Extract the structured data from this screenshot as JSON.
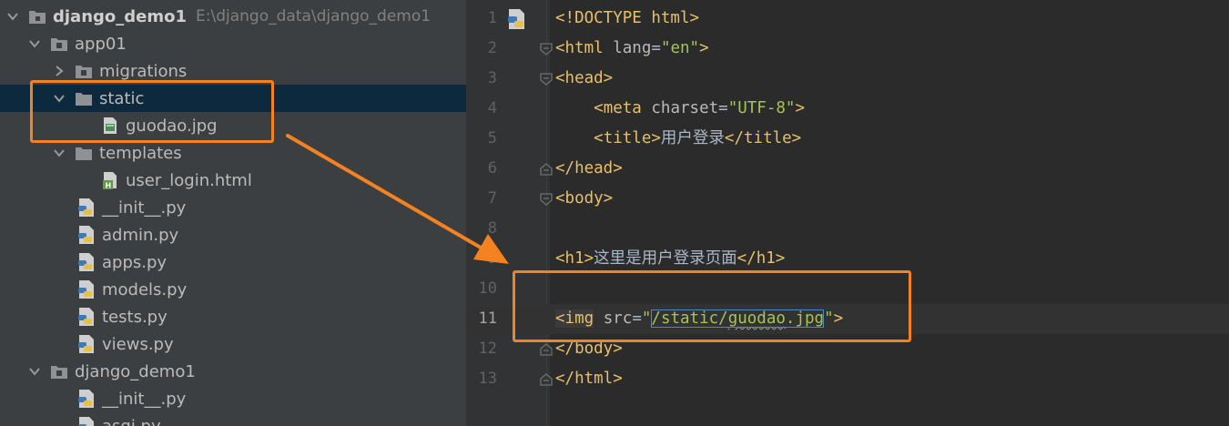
{
  "project": {
    "name": "django_demo1",
    "path": "E:\\django_data\\django_demo1",
    "tree": [
      {
        "label": "app01",
        "kind": "package",
        "expanded": true
      },
      {
        "label": "migrations",
        "kind": "package",
        "expanded": false
      },
      {
        "label": "static",
        "kind": "folder",
        "expanded": true,
        "selected": true
      },
      {
        "label": "guodao.jpg",
        "kind": "image"
      },
      {
        "label": "templates",
        "kind": "folder",
        "expanded": true
      },
      {
        "label": "user_login.html",
        "kind": "html"
      },
      {
        "label": "__init__.py",
        "kind": "python"
      },
      {
        "label": "admin.py",
        "kind": "python"
      },
      {
        "label": "apps.py",
        "kind": "python"
      },
      {
        "label": "models.py",
        "kind": "python"
      },
      {
        "label": "tests.py",
        "kind": "python"
      },
      {
        "label": "views.py",
        "kind": "python"
      },
      {
        "label": "django_demo1",
        "kind": "package",
        "expanded": true
      },
      {
        "label": "__init__.py",
        "kind": "python"
      },
      {
        "label": "asgi.py",
        "kind": "python"
      }
    ]
  },
  "editor": {
    "active_line": 11,
    "lines": [
      {
        "n": "1",
        "t": "<!DOCTYPE html>"
      },
      {
        "n": "2",
        "t": "<html lang=\"en\">"
      },
      {
        "n": "3",
        "t": "<head>"
      },
      {
        "n": "4",
        "t": "    <meta charset=\"UTF-8\">"
      },
      {
        "n": "5",
        "t": "    <title>用户登录</title>"
      },
      {
        "n": "6",
        "t": "</head>"
      },
      {
        "n": "7",
        "t": "<body>"
      },
      {
        "n": "8",
        "t": ""
      },
      {
        "n": "9",
        "t": "<h1>这里是用户登录页面</h1>"
      },
      {
        "n": "10",
        "t": ""
      },
      {
        "n": "11",
        "t": "<img src=\"/static/guodao.jpg\">"
      },
      {
        "n": "12",
        "t": "</body>"
      },
      {
        "n": "13",
        "t": "</html>"
      }
    ],
    "tokens": {
      "doctype": "<!DOCTYPE html>",
      "html_open": "<html",
      "lang_attr": "lang",
      "lang_val": "\"en\"",
      "head_open": "<head>",
      "meta_open": "<meta",
      "charset_attr": "charset",
      "charset_val": "\"UTF-8\"",
      "title_open": "<title>",
      "title_text": "用户登录",
      "title_close": "</title>",
      "head_close": "</head>",
      "body_open": "<body>",
      "h1_open": "<h1>",
      "h1_text": "这里是用户登录页面",
      "h1_close": "</h1>",
      "img_open": "<img",
      "src_attr": "src",
      "src_path_a": "/static/",
      "src_path_b": "guodao",
      "src_path_c": ".jpg",
      "body_close": "</body>",
      "html_close": "</html>"
    }
  },
  "colors": {
    "annotation": "#f58220",
    "tag": "#e8bf6a",
    "string": "#a5c25c",
    "selection": "#0d293e"
  }
}
